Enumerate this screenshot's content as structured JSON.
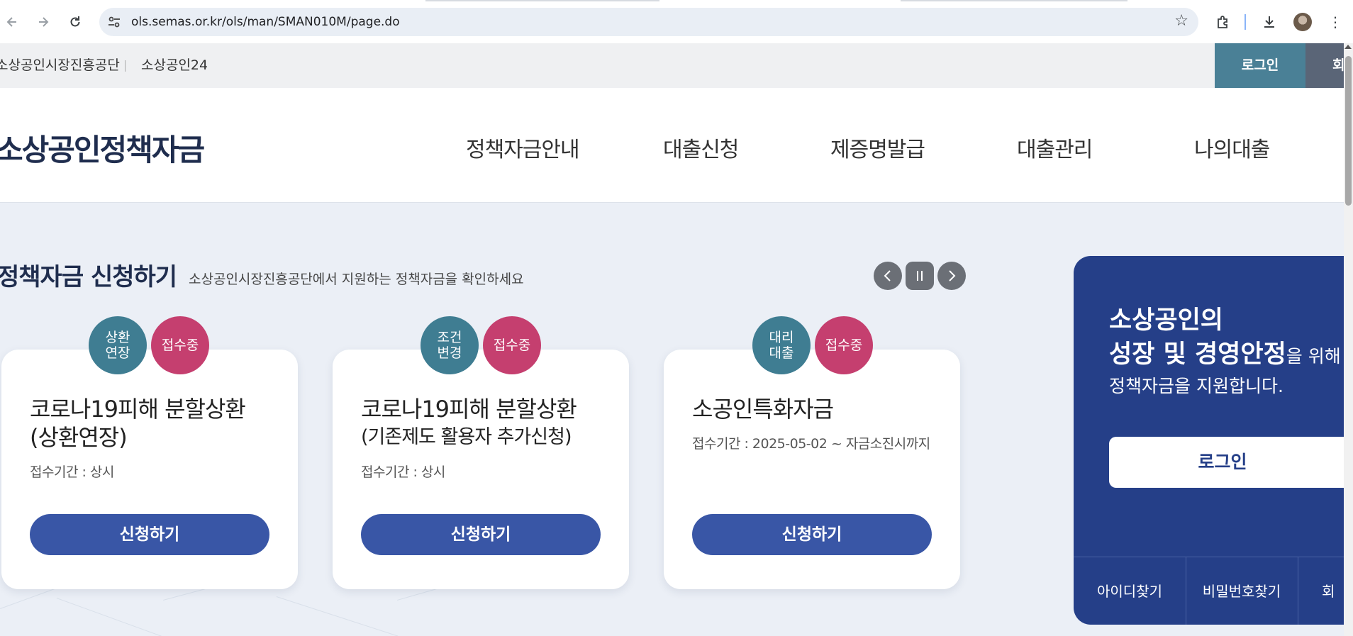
{
  "browser": {
    "url": "ols.semas.or.kr/ols/man/SMAN010M/page.do"
  },
  "util_bar": {
    "links": [
      "소상공인시장진흥공단",
      "소상공인24"
    ],
    "login": "로그인",
    "join": "회"
  },
  "header": {
    "logo": "소상공인정책자금",
    "nav": [
      "정책자금안내",
      "대출신청",
      "제증명발급",
      "대출관리",
      "나의대출"
    ]
  },
  "section": {
    "title_bold": "정책자금 ",
    "title_strong": "신청하기",
    "subtitle": "소상공인시장진흥공단에서 지원하는 정책자금을 확인하세요"
  },
  "cards": [
    {
      "badge1": [
        "상환",
        "연장"
      ],
      "badge2": "접수중",
      "title_line1": "코로나19피해 분할상환",
      "title_line2": "(상환연장)",
      "period": "접수기간 : 상시",
      "button": "신청하기"
    },
    {
      "badge1": [
        "조건",
        "변경"
      ],
      "badge2": "접수중",
      "title_line1": "코로나19피해 분할상환",
      "title_line2": "(기존제도 활용자 추가신청)",
      "period": "접수기간 : 상시",
      "button": "신청하기"
    },
    {
      "badge1": [
        "대리",
        "대출"
      ],
      "badge2": "접수중",
      "title_line1": "소공인특화자금",
      "title_line2": "",
      "period": "접수기간 : 2025-05-02 ~ 자금소진시까지",
      "button": "신청하기"
    }
  ],
  "panel": {
    "line1": "소상공인의",
    "line2_bold": "성장 및 경영안정",
    "line2_rest": "을 위해",
    "line3": "정책자금을 지원합니다.",
    "login_button": "로그인",
    "footer": [
      "아이디찾기",
      "비밀번호찾기",
      "회"
    ]
  },
  "icons": {
    "back": "arrow-left-icon",
    "forward": "arrow-right-icon",
    "reload": "reload-icon",
    "site_info": "tune-icon",
    "bookmark": "star-icon",
    "extensions": "puzzle-icon",
    "download": "download-icon",
    "menu": "kebab-menu-icon",
    "prev": "chevron-left-icon",
    "pause": "pause-icon",
    "next": "chevron-right-icon"
  },
  "colors": {
    "primary": "#3956a6",
    "panel": "#253f88",
    "teal": "#3f7d92",
    "pink": "#c53f6f",
    "login_bar": "#4a8096"
  }
}
